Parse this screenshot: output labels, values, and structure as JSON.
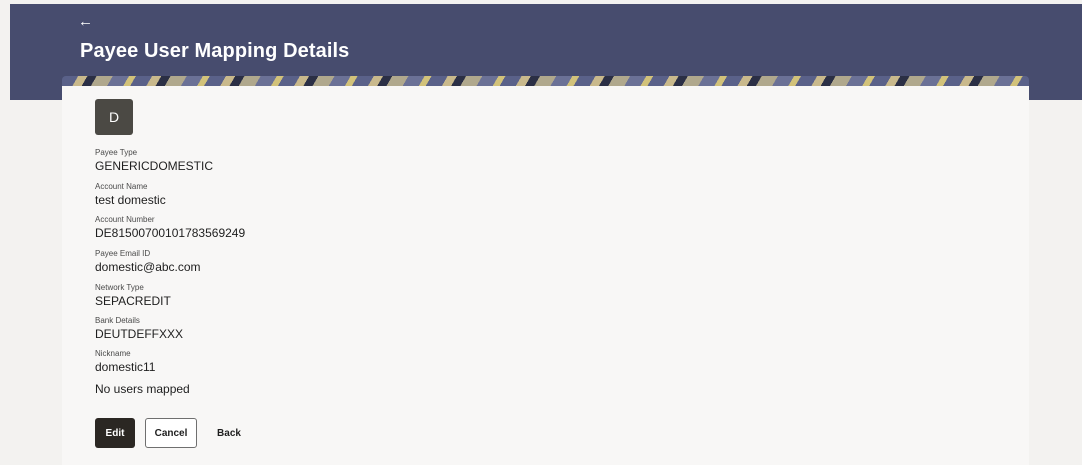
{
  "header": {
    "back_icon": "←",
    "title": "Payee User Mapping Details"
  },
  "avatar": {
    "initial": "D"
  },
  "fields": [
    {
      "label": "Payee Type",
      "value": "GENERICDOMESTIC"
    },
    {
      "label": "Account Name",
      "value": "test domestic"
    },
    {
      "label": "Account Number",
      "value": "DE81500700101783569249"
    },
    {
      "label": "Payee Email ID",
      "value": "domestic@abc.com"
    },
    {
      "label": "Network Type",
      "value": "SEPACREDIT"
    },
    {
      "label": "Bank Details",
      "value": "DEUTDEFFXXX"
    },
    {
      "label": "Nickname",
      "value": "domestic11"
    }
  ],
  "status": {
    "no_users": "No users mapped"
  },
  "actions": {
    "edit_label": "Edit",
    "cancel_label": "Cancel",
    "back_label": "Back"
  },
  "colors": {
    "header_bg": "#474c6e",
    "primary_button": "#2b2723",
    "page_bg": "#f3f2f0"
  }
}
